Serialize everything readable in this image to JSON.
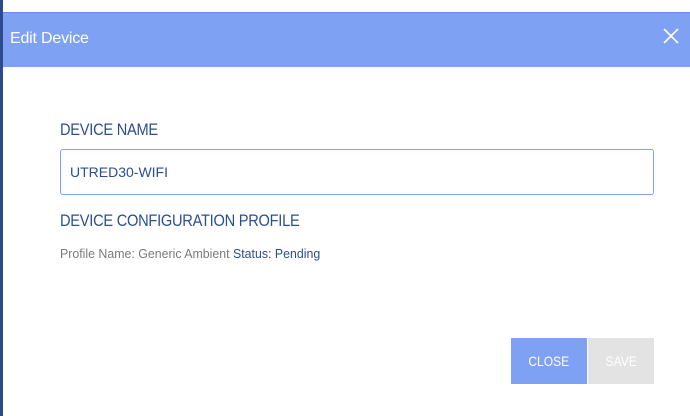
{
  "dialog": {
    "title": "Edit Device",
    "close_icon": "close-icon"
  },
  "device_name": {
    "heading": "DEVICE NAME",
    "value": "UTRED30-WIFI"
  },
  "profile": {
    "heading": "DEVICE CONFIGURATION PROFILE",
    "profile_name_label": "Profile Name:",
    "profile_name_value": "Generic Ambient",
    "status_label": "Status:",
    "status_value": "Pending"
  },
  "buttons": {
    "close_label": "CLOSE",
    "save_label": "SAVE",
    "save_enabled": false
  },
  "colors": {
    "titlebar": "#7ea1f3",
    "heading_text": "#2a4f8f",
    "muted_text": "#7a7a7a",
    "disabled_button": "#e3e3e3"
  }
}
